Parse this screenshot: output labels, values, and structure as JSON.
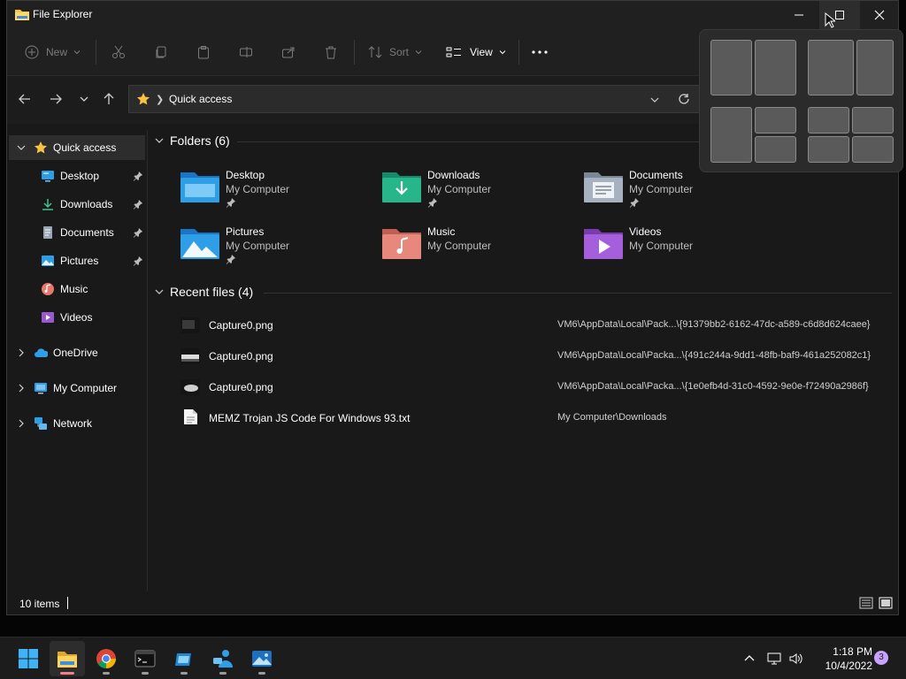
{
  "window": {
    "title": "File Explorer"
  },
  "toolbar": {
    "new_label": "New",
    "sort_label": "Sort",
    "view_label": "View"
  },
  "address": {
    "crumb": "Quick access"
  },
  "sidebar": {
    "items": [
      {
        "label": "Quick access"
      },
      {
        "label": "Desktop"
      },
      {
        "label": "Downloads"
      },
      {
        "label": "Documents"
      },
      {
        "label": "Pictures"
      },
      {
        "label": "Music"
      },
      {
        "label": "Videos"
      },
      {
        "label": "OneDrive"
      },
      {
        "label": "My Computer"
      },
      {
        "label": "Network"
      }
    ]
  },
  "folders": {
    "heading": "Folders (6)",
    "items": [
      {
        "name": "Desktop",
        "location": "My Computer"
      },
      {
        "name": "Downloads",
        "location": "My Computer"
      },
      {
        "name": "Documents",
        "location": "My Computer"
      },
      {
        "name": "Pictures",
        "location": "My Computer"
      },
      {
        "name": "Music",
        "location": "My Computer"
      },
      {
        "name": "Videos",
        "location": "My Computer"
      }
    ]
  },
  "recent": {
    "heading": "Recent files (4)",
    "items": [
      {
        "name": "Capture0.png",
        "path": "VM6\\AppData\\Local\\Pack...\\{91379bb2-6162-47dc-a589-c6d8d624caee}"
      },
      {
        "name": "Capture0.png",
        "path": "VM6\\AppData\\Local\\Packa...\\{491c244a-9dd1-48fb-baf9-461a252082c1}"
      },
      {
        "name": "Capture0.png",
        "path": "VM6\\AppData\\Local\\Packa...\\{1e0efb4d-31c0-4592-9e0e-f72490a2986f}"
      },
      {
        "name": "MEMZ Trojan JS Code For Windows 93.txt",
        "path": "My Computer\\Downloads"
      }
    ]
  },
  "status": {
    "items_count": "10 items"
  },
  "taskbar": {
    "time": "1:18 PM",
    "date": "10/4/2022",
    "notifications": "3"
  },
  "colors": {
    "accent": "#f37f8a",
    "folder_blue": "#2e9fe6",
    "selection": "#2d2d2d"
  }
}
